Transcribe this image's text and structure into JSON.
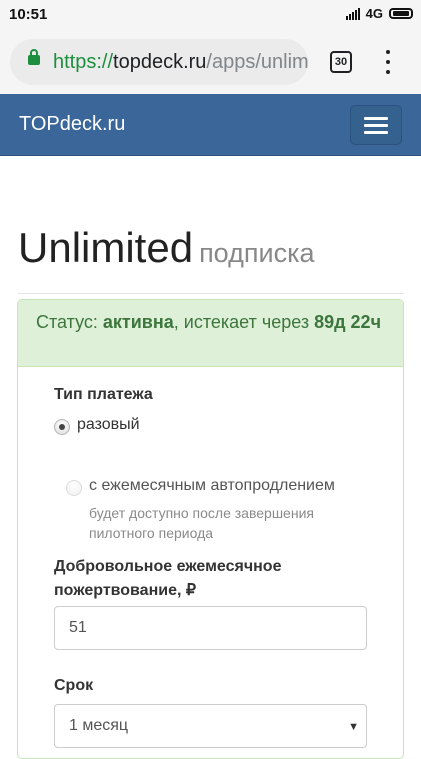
{
  "statusbar": {
    "time": "10:51",
    "network": "4G"
  },
  "browser": {
    "url_scheme": "https://",
    "url_host": "topdeck.ru",
    "url_path": "/apps/unlim",
    "tab_count": "30"
  },
  "navbar": {
    "brand": "TOPdeck.ru"
  },
  "page": {
    "title": "Unlimited",
    "subtitle": "подписка"
  },
  "status": {
    "prefix": "Статус: ",
    "state": "активна",
    "middle": ", истекает через ",
    "remaining": "89д 22ч"
  },
  "form": {
    "payment_type_label": "Тип платежа",
    "option_once": "разовый",
    "option_monthly": "с ежемесячным автопродлением",
    "option_monthly_help": "будет доступно после завершения пилотного периода",
    "donation_label": "Добровольное ежемесячное пожертвование, ₽",
    "donation_value": "51",
    "term_label": "Срок",
    "term_value": "1 месяц"
  }
}
